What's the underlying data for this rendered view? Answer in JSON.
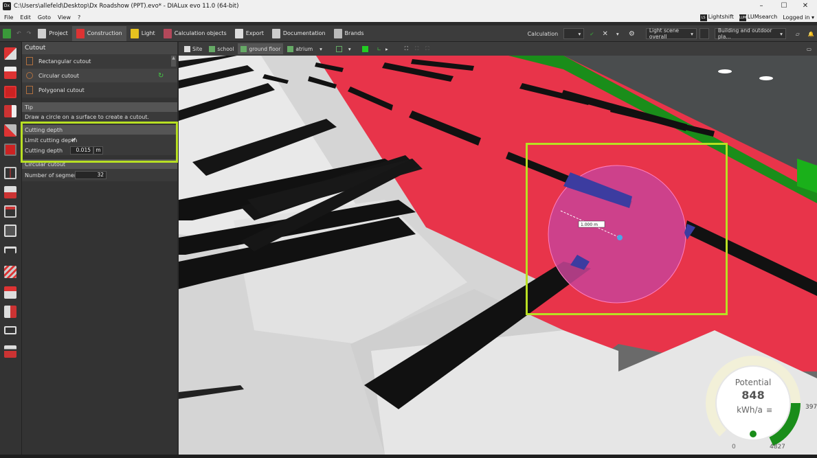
{
  "window": {
    "title": "C:\\Users\\allefeld\\Desktop\\Dx Roadshow (PPT).evo* - DIALux evo 11.0  (64-bit)",
    "app_icon": "dialux-logo",
    "minimize": "–",
    "maximize": "☐",
    "close": "✕"
  },
  "menu": {
    "items": [
      "File",
      "Edit",
      "Goto",
      "View",
      "?"
    ],
    "lightshift": "Lightshift",
    "lumsearch": "LUMsearch",
    "logged_in": "Logged in"
  },
  "toolbar": {
    "tabs": [
      {
        "label": "Project",
        "icon": "project-icon"
      },
      {
        "label": "Construction",
        "icon": "construction-icon",
        "active": true
      },
      {
        "label": "Light",
        "icon": "light-icon"
      },
      {
        "label": "Calculation objects",
        "icon": "calculation-objects-icon"
      },
      {
        "label": "Export",
        "icon": "export-icon"
      },
      {
        "label": "Documentation",
        "icon": "documentation-icon"
      },
      {
        "label": "Brands",
        "icon": "brands-icon"
      }
    ],
    "calculation_label": "Calculation",
    "light_scene": "Light scene overall",
    "building": "Building and outdoor pla..."
  },
  "panel": {
    "title": "Cutout",
    "tools": [
      {
        "label": "Rectangular cutout",
        "icon": "rectangle-cutout-icon"
      },
      {
        "label": "Circular cutout",
        "icon": "circle-cutout-icon",
        "active": true
      },
      {
        "label": "Polygonal cutout",
        "icon": "polygon-cutout-icon"
      }
    ],
    "tip_header": "Tip",
    "tip_text": "Draw a circle on a surface to create a cutout.",
    "cutting_depth_header": "Cutting depth",
    "limit_label": "Limit cutting depth",
    "limit_checked": true,
    "depth_label": "Cutting depth",
    "depth_value": "0.015",
    "depth_unit": "m",
    "circular_header": "Circular cutout",
    "segments_label": "Number of segments",
    "segments_value": "32"
  },
  "view": {
    "site": "Site",
    "building": "school",
    "floor": "ground floor",
    "room": "atrium"
  },
  "scene": {
    "measurement": "1.000 m"
  },
  "energy": {
    "label": "Potential",
    "value": "848",
    "unit": "kWh/a",
    "min": "0",
    "max": "4827",
    "side": "397"
  },
  "colors": {
    "highlight": "#b8e023",
    "floor": "#e8344a",
    "accent": "#1a8d1a"
  }
}
